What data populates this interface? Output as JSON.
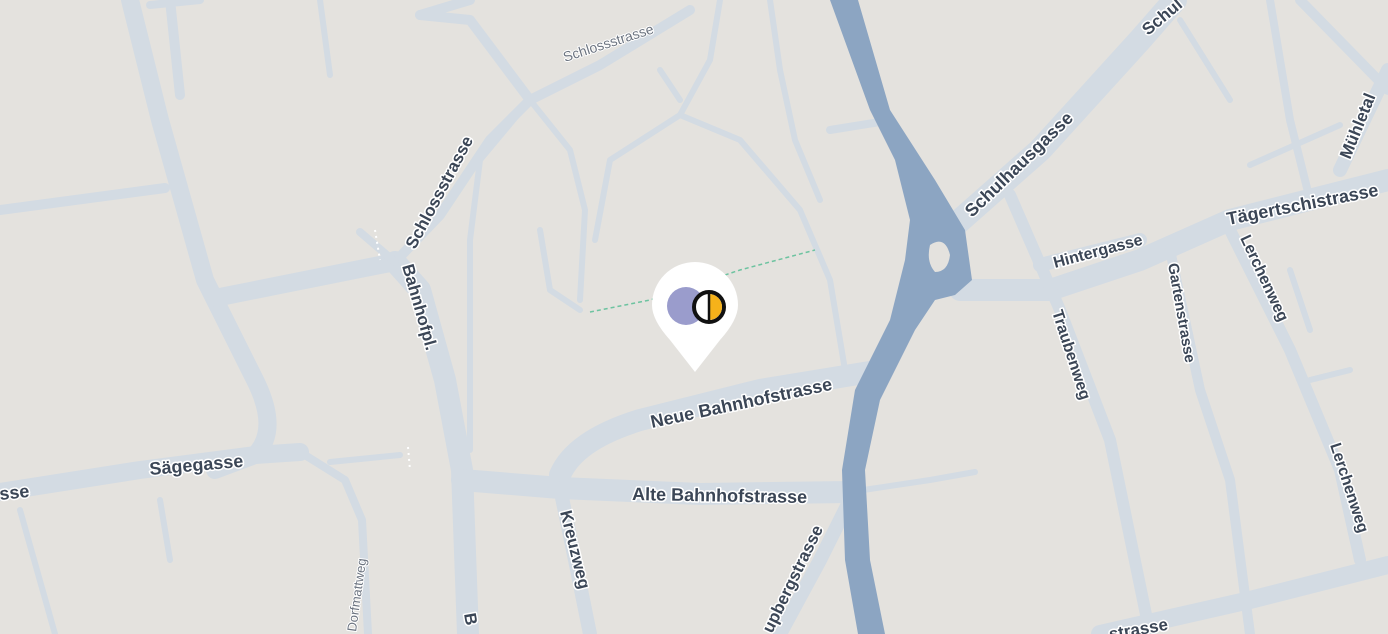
{
  "map": {
    "colors": {
      "background": "#e4e2de",
      "road": "#d3dbe3",
      "road_minor": "#d6dde4",
      "river": "#8ca5c2",
      "footpath": "#6dc3a0",
      "pin": "#ffffff",
      "marker_outline": "#111111",
      "marker_accent": "#f6b21a",
      "marker_halo": "#9a9ccc",
      "label_text": "#3b4656"
    },
    "streets": {
      "schlossstrasse_upper": "Schlossstrasse",
      "schlossstrasse_lower": "Schlossstrasse",
      "bahnhofpl": "Bahnhofpl.",
      "saegegasse": "Sägegasse",
      "sse_fragment": "sse",
      "neue_bahnhofstrasse": "Neue Bahnhofstrasse",
      "alte_bahnhofstrasse": "Alte Bahnhofstrasse",
      "kreuzweg": "Kreuzweg",
      "dorfmattweg": "Dorfmattweg",
      "b_fragment": "B",
      "upbergstrasse": "upbergstrasse",
      "schulhausgasse": "Schulhausgasse",
      "schul_fragment": "Schul",
      "hintergasse": "Hintergasse",
      "taegertschistrasse": "Tägertschistrasse",
      "muehletal_fragment": "Mühletal",
      "traubenweg": "Traubenweg",
      "gartenstrasse": "Gartenstrasse",
      "lerchenweg_upper": "Lerchenweg",
      "lerchenweg_lower": "Lerchenweg",
      "strasse_fragment": "strasse"
    },
    "marker": {
      "icon": "map-pin-icon",
      "inner_icon": "half-circle-icon"
    }
  }
}
